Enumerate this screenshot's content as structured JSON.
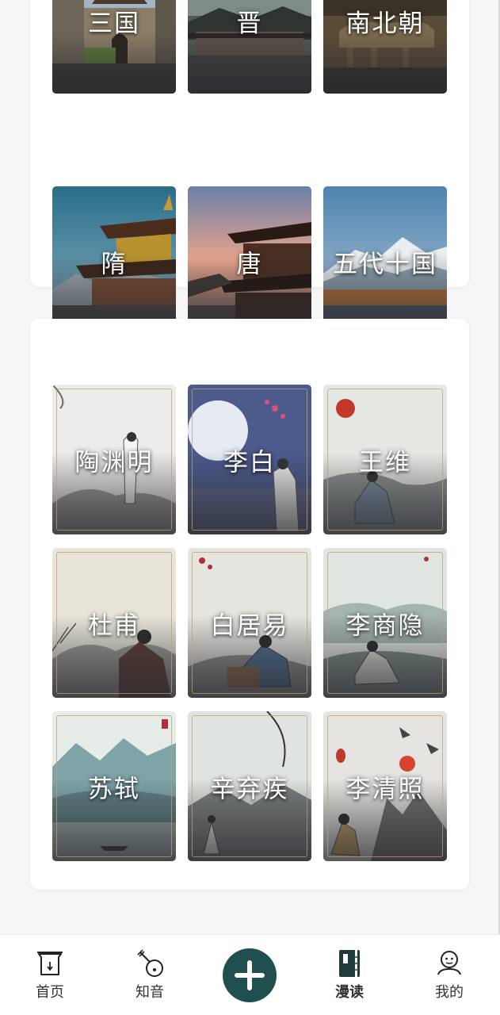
{
  "dynasties": [
    {
      "label": "三国",
      "theme": "city-gate"
    },
    {
      "label": "晋",
      "theme": "temple-roofs"
    },
    {
      "label": "南北朝",
      "theme": "terracotta-horses"
    },
    {
      "label": "隋",
      "theme": "pavilion-sky"
    },
    {
      "label": "唐",
      "theme": "tower-sunset"
    },
    {
      "label": "五代十国",
      "theme": "snow-mountain-lake"
    }
  ],
  "poets": [
    {
      "label": "陶渊明"
    },
    {
      "label": "李白"
    },
    {
      "label": "王维"
    },
    {
      "label": "杜甫"
    },
    {
      "label": "白居易"
    },
    {
      "label": "李商隐"
    },
    {
      "label": "苏轼"
    },
    {
      "label": "辛弃疾"
    },
    {
      "label": "李清照"
    }
  ],
  "tabbar": {
    "items": [
      {
        "label": "首页",
        "icon": "home-gate-icon"
      },
      {
        "label": "知音",
        "icon": "pipa-icon"
      },
      {
        "label": "漫读",
        "icon": "book-icon",
        "active": true
      },
      {
        "label": "我的",
        "icon": "profile-icon"
      }
    ],
    "center_icon": "plus-icon"
  },
  "colors": {
    "accent": "#1f4f4f",
    "frame_gold": "#bea06e",
    "background": "#f6f6f6"
  }
}
